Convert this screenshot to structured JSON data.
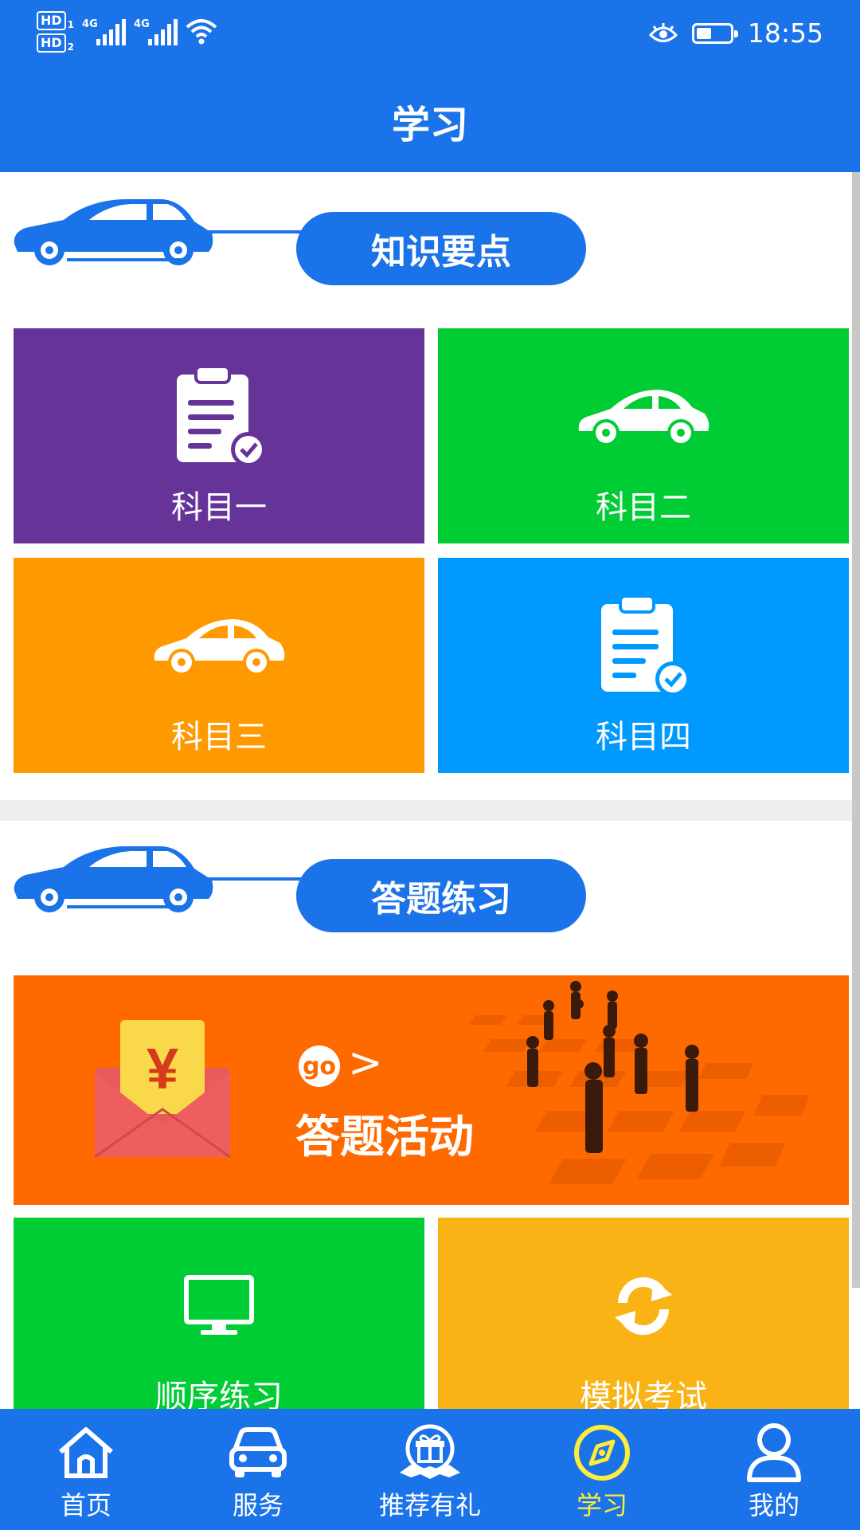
{
  "status_bar": {
    "sim1_label": "HD",
    "sim1_index": "1",
    "sim2_label": "HD",
    "sim2_index": "2",
    "network1": "4G",
    "network2": "4G",
    "time": "18:55",
    "battery_level": 0.45,
    "icons": [
      "signal-icon",
      "wifi-icon",
      "eye-comfort-icon",
      "battery-icon"
    ]
  },
  "header": {
    "title": "学习"
  },
  "sections": {
    "knowledge": {
      "title": "知识要点",
      "tiles": [
        {
          "label": "科目一",
          "color": "#663399",
          "icon": "clipboard-check-icon"
        },
        {
          "label": "科目二",
          "color": "#00cc33",
          "icon": "car-icon"
        },
        {
          "label": "科目三",
          "color": "#ff9900",
          "icon": "car-icon"
        },
        {
          "label": "科目四",
          "color": "#0099ff",
          "icon": "clipboard-check-icon"
        }
      ]
    },
    "practice": {
      "title": "答题练习",
      "banner": {
        "go": "go",
        "arrow": ">",
        "title": "答题活动",
        "color": "#ff6a00",
        "currency_symbol": "¥"
      },
      "tiles": [
        {
          "label": "顺序练习",
          "color": "#00cc33",
          "icon": "monitor-icon"
        },
        {
          "label": "模拟考试",
          "color": "#f9b315",
          "icon": "refresh-icon"
        }
      ]
    }
  },
  "tab_bar": {
    "items": [
      {
        "label": "首页",
        "icon": "home-icon",
        "active": false
      },
      {
        "label": "服务",
        "icon": "car-front-icon",
        "active": false
      },
      {
        "label": "推荐有礼",
        "icon": "gift-badge-icon",
        "active": false
      },
      {
        "label": "学习",
        "icon": "compass-icon",
        "active": true
      },
      {
        "label": "我的",
        "icon": "user-icon",
        "active": false
      }
    ]
  },
  "colors": {
    "primary": "#1a73e8",
    "active_tab": "#ffeb3b"
  }
}
